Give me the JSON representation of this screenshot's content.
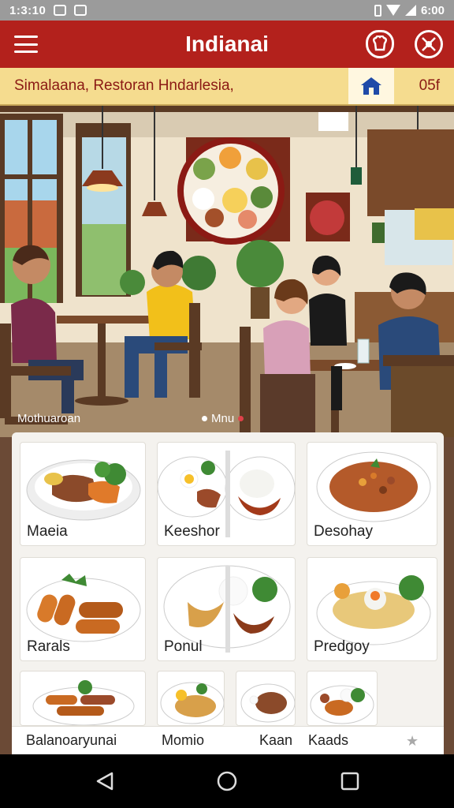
{
  "status_bar": {
    "time": "1:3:10",
    "right_text": "6:00"
  },
  "app_bar": {
    "title": "Indianai",
    "icons": [
      "menu-icon",
      "chef-icon",
      "dish-icon"
    ]
  },
  "info_bar": {
    "location": "Simalaana,   Restoran Hndarlesia,",
    "right_text": "05f",
    "icons": [
      "home-icon"
    ]
  },
  "menu_header": {
    "left_label": "Mothuaroan",
    "center_label": "Mnu"
  },
  "menu_items": [
    {
      "name": "Maeia"
    },
    {
      "name": "Keeshor"
    },
    {
      "name": "Desohay"
    },
    {
      "name": "Rarals"
    },
    {
      "name": "Ponul"
    },
    {
      "name": "Predgoy"
    }
  ],
  "bottom_row": [
    {
      "name": "Balanoaryunai"
    },
    {
      "name": "Momio"
    },
    {
      "name": "Kaan"
    },
    {
      "name": "Kaads"
    }
  ],
  "colors": {
    "app_bar": "#b3211c",
    "info_bar": "#f5dc8f",
    "accent_text": "#8b1a14",
    "home_icon": "#1f4aa8"
  },
  "nav_bar": {
    "icons": [
      "back-icon",
      "home-circle-icon",
      "recent-apps-icon"
    ]
  }
}
